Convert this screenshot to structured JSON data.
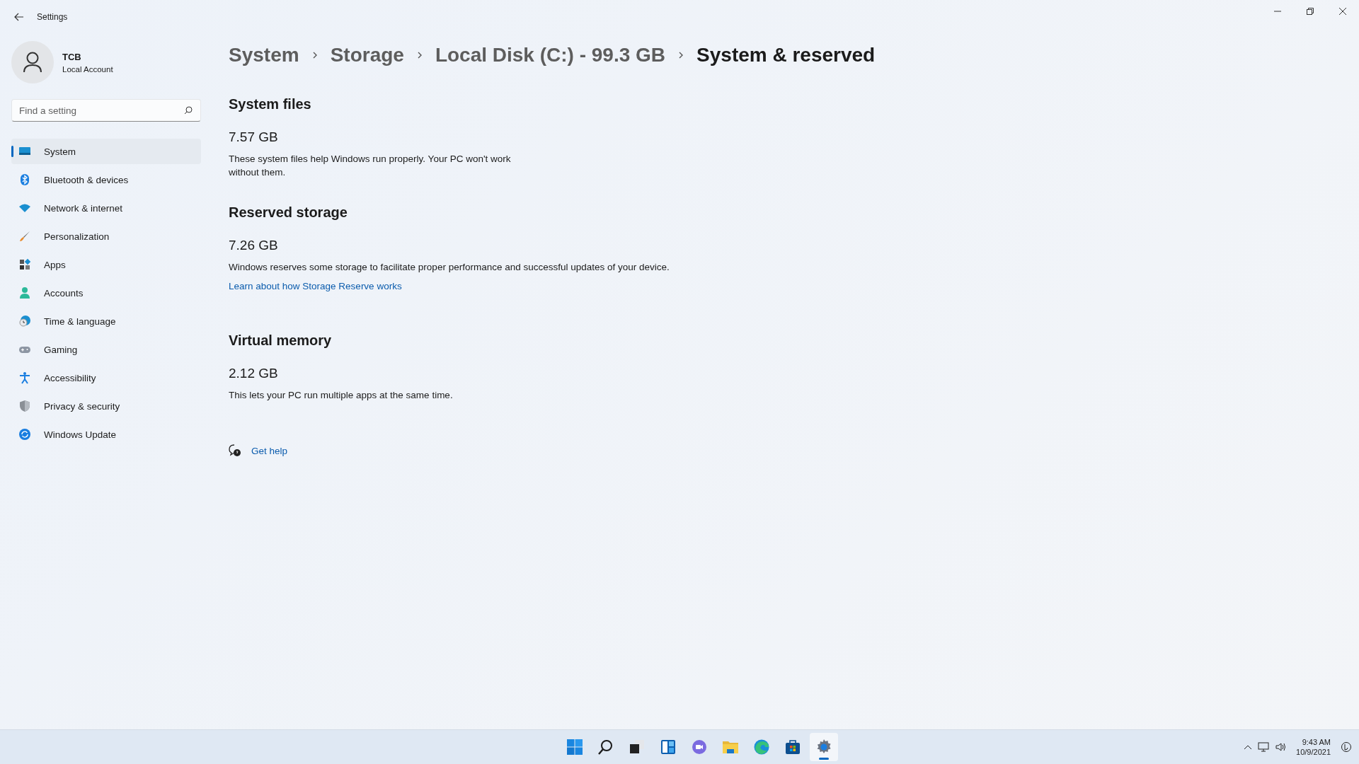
{
  "window": {
    "title": "Settings"
  },
  "user": {
    "name": "TCB",
    "account": "Local Account"
  },
  "search": {
    "placeholder": "Find a setting"
  },
  "nav": [
    {
      "label": "System",
      "kind": "system",
      "selected": true
    },
    {
      "label": "Bluetooth & devices",
      "kind": "bluetooth",
      "selected": false
    },
    {
      "label": "Network & internet",
      "kind": "network",
      "selected": false
    },
    {
      "label": "Personalization",
      "kind": "brush",
      "selected": false
    },
    {
      "label": "Apps",
      "kind": "apps",
      "selected": false
    },
    {
      "label": "Accounts",
      "kind": "accounts",
      "selected": false
    },
    {
      "label": "Time & language",
      "kind": "time",
      "selected": false
    },
    {
      "label": "Gaming",
      "kind": "gaming",
      "selected": false
    },
    {
      "label": "Accessibility",
      "kind": "accessibility",
      "selected": false
    },
    {
      "label": "Privacy & security",
      "kind": "privacy",
      "selected": false
    },
    {
      "label": "Windows Update",
      "kind": "update",
      "selected": false
    }
  ],
  "breadcrumb": [
    "System",
    "Storage",
    "Local Disk (C:) - 99.3 GB",
    "System & reserved"
  ],
  "sections": [
    {
      "title": "System files",
      "size": "7.57 GB",
      "description": "These system files help Windows run properly. Your PC won't work without them."
    },
    {
      "title": "Reserved storage",
      "size": "7.26 GB",
      "description": "Windows reserves some storage to facilitate proper performance and successful updates of your device.",
      "link": "Learn about how Storage Reserve works"
    },
    {
      "title": "Virtual memory",
      "size": "2.12 GB",
      "description": "This lets your PC run multiple apps at the same time."
    }
  ],
  "help": {
    "label": "Get help"
  },
  "taskbar": [
    {
      "kind": "start",
      "selected": false
    },
    {
      "kind": "search",
      "selected": false
    },
    {
      "kind": "taskview",
      "selected": false
    },
    {
      "kind": "widgets",
      "selected": false
    },
    {
      "kind": "chat",
      "selected": false
    },
    {
      "kind": "explorer",
      "selected": false
    },
    {
      "kind": "edge",
      "selected": false
    },
    {
      "kind": "store",
      "selected": false
    },
    {
      "kind": "settings",
      "selected": true
    }
  ],
  "tray": {
    "time": "9:43 AM",
    "date": "10/9/2021"
  }
}
